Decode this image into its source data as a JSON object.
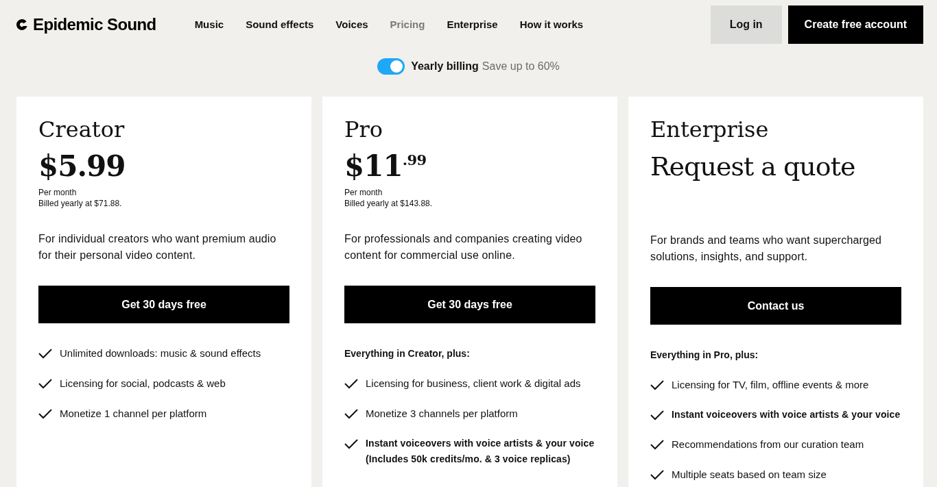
{
  "header": {
    "logo": "Epidemic Sound",
    "nav": [
      {
        "label": "Music",
        "selected": false
      },
      {
        "label": "Sound effects",
        "selected": false
      },
      {
        "label": "Voices",
        "selected": false
      },
      {
        "label": "Pricing",
        "selected": true
      },
      {
        "label": "Enterprise",
        "selected": false
      },
      {
        "label": "How it works",
        "selected": false
      }
    ],
    "buttons": [
      {
        "label": "Log in",
        "kind": "login"
      },
      {
        "label": "Create free account",
        "kind": "signup"
      }
    ]
  },
  "billing": {
    "on": true,
    "label": "Yearly billing",
    "note": "Save up to 60%"
  },
  "plans": [
    {
      "kind": "priced",
      "name": "Creator",
      "price": "$5.99",
      "period": "Per month",
      "billed": "Billed yearly at $71.88.",
      "description": "For individual creators who want premium audio for their personal video content.",
      "button": "Get 30 days free",
      "features": [
        {
          "text": "Unlimited downloads: music & sound effects",
          "bold": false
        },
        {
          "text": "Licensing for social, podcasts & web",
          "bold": false
        },
        {
          "text": "Monetize 1 channel per platform",
          "bold": false
        }
      ]
    },
    {
      "kind": "priced",
      "name": "Pro",
      "price": "$11$^{.99}$",
      "period": "Per month",
      "billed": "Billed yearly at $143.88.",
      "description": "For professionals and companies creating video content for commercial use online.",
      "button": "Get 30 days free",
      "features_heading": "Everything in Creator, plus:",
      "features": [
        {
          "text": "Licensing for business, client work & digital ads",
          "bold": false
        },
        {
          "text": "Monetize 3 channels per platform",
          "bold": false
        },
        {
          "text": "Instant voiceovers with voice artists & your voice (Includes 50k credits/mo. & 3 voice replicas)",
          "bold": true
        }
      ]
    },
    {
      "kind": "quote",
      "name": "Enterprise",
      "price": "Request a quote",
      "description": "For brands and teams who want supercharged solutions, insights, and support.",
      "button": "Contact us",
      "features_heading": "Everything in Pro, plus:",
      "features": [
        {
          "text": "Licensing for TV, film, offline events & more",
          "bold": false
        },
        {
          "text": "Instant voiceovers with voice artists & your voice",
          "bold": true
        },
        {
          "text": "Recommendations from our curation team",
          "bold": false
        },
        {
          "text": "Multiple seats based on team size",
          "bold": false
        }
      ]
    }
  ]
}
